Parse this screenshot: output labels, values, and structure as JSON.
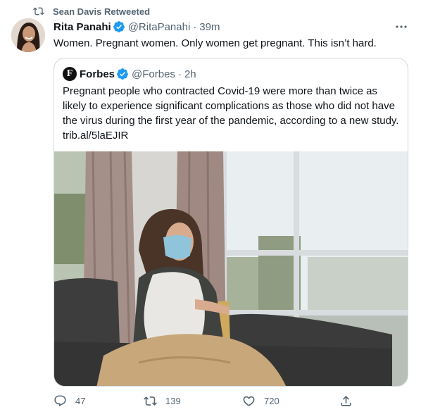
{
  "retweet": {
    "label": "Sean Davis Retweeted"
  },
  "tweet": {
    "author_name": "Rita Panahi",
    "author_handle": "@RitaPanahi",
    "separator": "·",
    "time": "39m",
    "text": "Women. Pregnant women. Only women get pregnant. This isn’t hard."
  },
  "quote": {
    "author_name": "Forbes",
    "author_initial": "F",
    "author_handle": "@Forbes",
    "separator": "·",
    "time": "2h",
    "text": "Pregnant people who contracted Covid-19 were more than twice as likely to experience significant complications as those who did not have the virus during the first year of the pandemic, according to a new study. trib.al/5laEJIR"
  },
  "actions": {
    "reply_count": "47",
    "retweet_count": "139",
    "like_count": "720"
  },
  "icons": {
    "retweet": "retweet-icon",
    "verified": "verified-badge-icon",
    "more": "more-icon",
    "reply": "reply-icon",
    "like": "heart-icon",
    "share": "share-icon"
  },
  "colors": {
    "verified": "#1d9bf0",
    "muted": "#536471",
    "text": "#0f1419",
    "border": "#cfd9de"
  }
}
